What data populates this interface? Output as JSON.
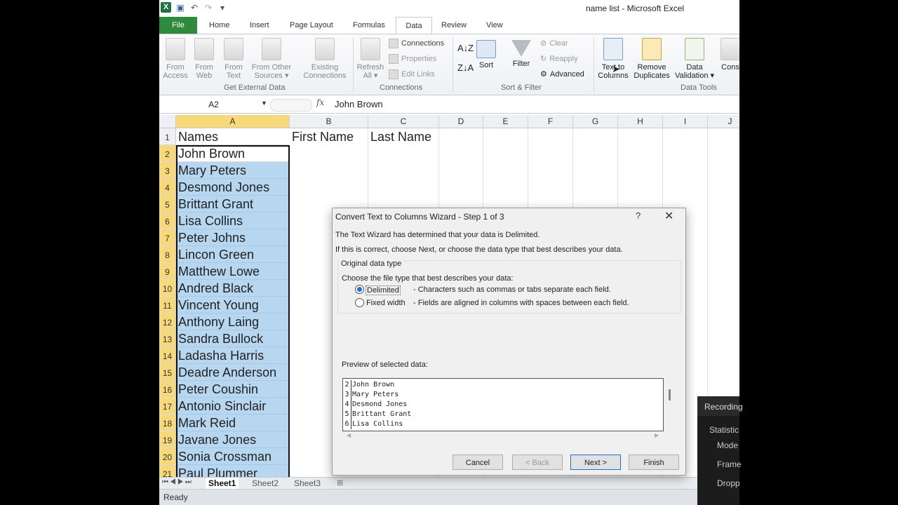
{
  "window_title": "name list  -  Microsoft Excel",
  "tabs": [
    "File",
    "Home",
    "Insert",
    "Page Layout",
    "Formulas",
    "Data",
    "Review",
    "View"
  ],
  "active_tab": "Data",
  "ribbon": {
    "get_external_data": {
      "from_access": [
        "From",
        "Access"
      ],
      "from_web": [
        "From",
        "Web"
      ],
      "from_text": [
        "From",
        "Text"
      ],
      "from_other": [
        "From Other",
        "Sources ▾"
      ],
      "existing": [
        "Existing",
        "Connections"
      ],
      "group_label": "Get External Data"
    },
    "connections": {
      "refresh": [
        "Refresh",
        "All ▾"
      ],
      "connections": "Connections",
      "properties": "Properties",
      "edit_links": "Edit Links",
      "group_label": "Connections"
    },
    "sort_filter": {
      "sort": "Sort",
      "filter": "Filter",
      "clear": "Clear",
      "reapply": "Reapply",
      "advanced": "Advanced",
      "group_label": "Sort & Filter"
    },
    "data_tools": {
      "text_to_columns": [
        "Text to",
        "Columns"
      ],
      "remove_duplicates": [
        "Remove",
        "Duplicates"
      ],
      "data_validation": [
        "Data",
        "Validation ▾"
      ],
      "consolidate": "Cons",
      "group_label": "Data Tools"
    }
  },
  "formula_bar": {
    "name_box": "A2",
    "fx": "fx",
    "value": "John Brown"
  },
  "columns": [
    "A",
    "B",
    "C",
    "D",
    "E",
    "F",
    "G",
    "H",
    "I",
    "J"
  ],
  "header_row": {
    "a": "Names",
    "b": "First Name",
    "c": "Last Name"
  },
  "row_numbers": [
    "1",
    "2",
    "3",
    "4",
    "5",
    "6",
    "7",
    "8",
    "9",
    "10",
    "11",
    "12",
    "13",
    "14",
    "15",
    "16",
    "17",
    "18",
    "19",
    "20",
    "21"
  ],
  "names": [
    "John Brown",
    "Mary Peters",
    "Desmond Jones",
    "Brittant Grant",
    "Lisa Collins",
    "Peter Johns",
    "Lincon Green",
    "Matthew Lowe",
    "Andred Black",
    "Vincent Young",
    "Anthony Laing",
    "Sandra Bullock",
    "Ladasha Harris",
    "Deadre Anderson",
    "Peter Coushin",
    "Antonio Sinclair",
    "Mark Reid",
    "Javane Jones",
    "Sonia Crossman",
    "Paul Plummer"
  ],
  "sheets": [
    "Sheet1",
    "Sheet2",
    "Sheet3"
  ],
  "status": "Ready",
  "dialog": {
    "title": "Convert Text to Columns Wizard - Step 1 of 3",
    "help": "?",
    "close": "✕",
    "line1": "The Text Wizard has determined that your data is Delimited.",
    "line2": "If this is correct, choose Next, or choose the data type that best describes your data.",
    "group_label": "Original data type",
    "prompt": "Choose the file type that best describes your data:",
    "options": [
      {
        "label": "Delimited",
        "desc": "- Characters such as commas or tabs separate each field.",
        "checked": true
      },
      {
        "label": "Fixed width",
        "desc": "- Fields are aligned in columns with spaces between each field.",
        "checked": false
      }
    ],
    "preview_label": "Preview of selected data:",
    "preview": [
      {
        "n": "2",
        "text": "John Brown"
      },
      {
        "n": "3",
        "text": "Mary Peters"
      },
      {
        "n": "4",
        "text": "Desmond Jones"
      },
      {
        "n": "5",
        "text": "Brittant Grant"
      },
      {
        "n": "6",
        "text": "Lisa Collins"
      }
    ],
    "buttons": {
      "cancel": "Cancel",
      "back": "< Back",
      "next": "Next >",
      "finish": "Finish"
    }
  },
  "recording": {
    "title": "Recording",
    "statistics": "Statistic",
    "mode": "Mode",
    "frame": "Frame",
    "dropped": "Dropp"
  }
}
